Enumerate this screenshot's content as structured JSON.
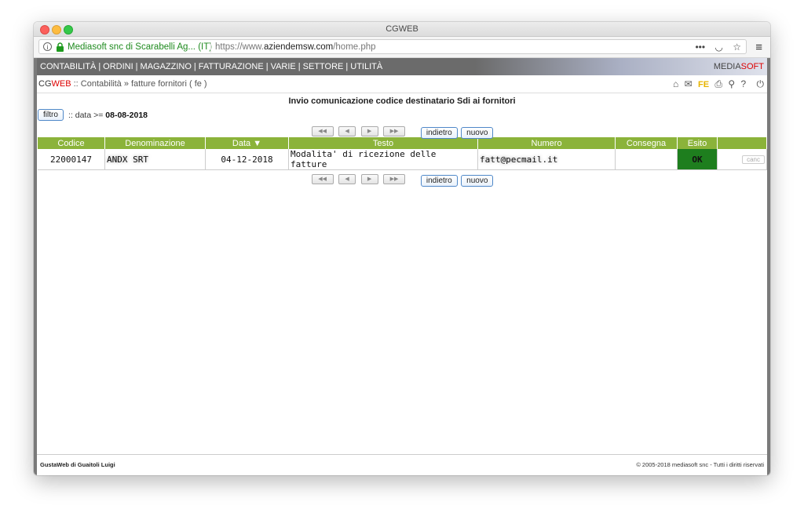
{
  "window": {
    "title": "CGWEB"
  },
  "urlbar": {
    "site_label": "Mediasoft snc di Scarabelli Ag... (IT)",
    "url_prefix": "https://www.",
    "url_domain": "aziendemsw.com",
    "url_path": "/home.php"
  },
  "navbar": {
    "items": [
      "CONTABILITÀ",
      "ORDINI",
      "MAGAZZINO",
      "FATTURAZIONE",
      "VARIE",
      "SETTORE",
      "UTILITÀ"
    ],
    "brand_media": "MEDIA",
    "brand_soft": "SOFT"
  },
  "breadcrumb": {
    "cg": "CG",
    "web": "WEB",
    "path": " :: Contabilità » fatture fornitori ( fe )",
    "fe_label": "FE"
  },
  "page": {
    "heading": "Invio comunicazione codice destinatario Sdi ai fornitori",
    "filter_button": "filtro",
    "filter_condition": ":: data >= ",
    "filter_value": "08-08-2018",
    "back_button": "indietro",
    "new_button": "nuovo"
  },
  "table": {
    "columns": [
      "Codice",
      "Denominazione",
      "Data ▼",
      "Testo",
      "Numero",
      "Consegna",
      "Esito",
      ""
    ],
    "rows": [
      {
        "codice": "22000147",
        "denominazione": "ANDX SRT",
        "data": "04-12-2018",
        "testo": "Modalita' di ricezione delle fatture",
        "numero": "fatt@pecmail.it",
        "consegna": "",
        "esito": "OK",
        "action": "canc"
      }
    ]
  },
  "footer": {
    "left": "GustaWeb di Guaitoli Luigi",
    "right": "© 2005-2018 mediasoft snc - Tutti i diritti riservati"
  }
}
